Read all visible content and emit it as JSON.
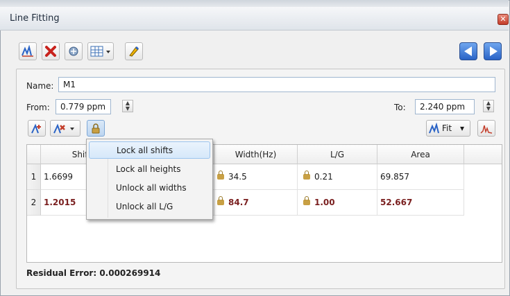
{
  "window": {
    "title": "Line Fitting",
    "close_glyph": "✕"
  },
  "toolbar": {
    "icons": [
      "fit-lines-icon",
      "delete-icon",
      "auto-pick-icon",
      "table-layout-icon",
      "pen-icon"
    ],
    "nav": [
      "previous-icon",
      "next-icon"
    ]
  },
  "form": {
    "name_label": "Name:",
    "name_value": "M1",
    "from_label": "From:",
    "from_value": "0.779 ppm",
    "to_label": "To:",
    "to_value": "2.240 ppm"
  },
  "actions": {
    "fit_label": "Fit",
    "dropdown_glyph": "▾"
  },
  "table": {
    "columns": [
      "Shift(p",
      "Width(Hz)",
      "L/G",
      "Area"
    ],
    "rows": [
      {
        "index": "1",
        "shift": "1.6699",
        "width": "34.5",
        "lg": "0.21",
        "area": "69.857",
        "bold": false
      },
      {
        "index": "2",
        "shift": "1.2015",
        "width": "84.7",
        "lg": "1.00",
        "area": "52.667",
        "bold": true
      }
    ]
  },
  "menu": {
    "items": [
      "Lock all shifts",
      "Lock all heights",
      "Unlock all widths",
      "Unlock all L/G"
    ],
    "highlighted_index": 0
  },
  "status": {
    "residual_error": "Residual Error: 0.000269914"
  },
  "colors": {
    "accent": "#2a63c6",
    "bold_row": "#7a1f1f",
    "lock": "#c8a044",
    "highlight": "#d6e8fa"
  }
}
